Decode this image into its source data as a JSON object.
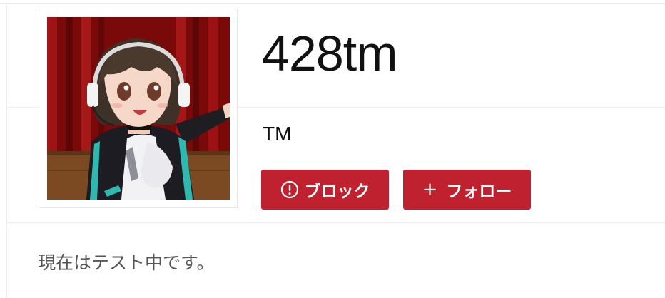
{
  "profile": {
    "username": "428tm",
    "display_name": "TM",
    "bio": "現在はテスト中です。",
    "avatar_alt": "avatar"
  },
  "actions": {
    "block_label": "ブロック",
    "block_icon": "alert-circle-icon",
    "follow_label": "フォロー",
    "follow_icon": "plus-icon",
    "follow_symbol": "+"
  },
  "colors": {
    "button_bg": "#c0212e",
    "button_text": "#ffffff",
    "text_primary": "#111111",
    "text_secondary": "#555555"
  }
}
